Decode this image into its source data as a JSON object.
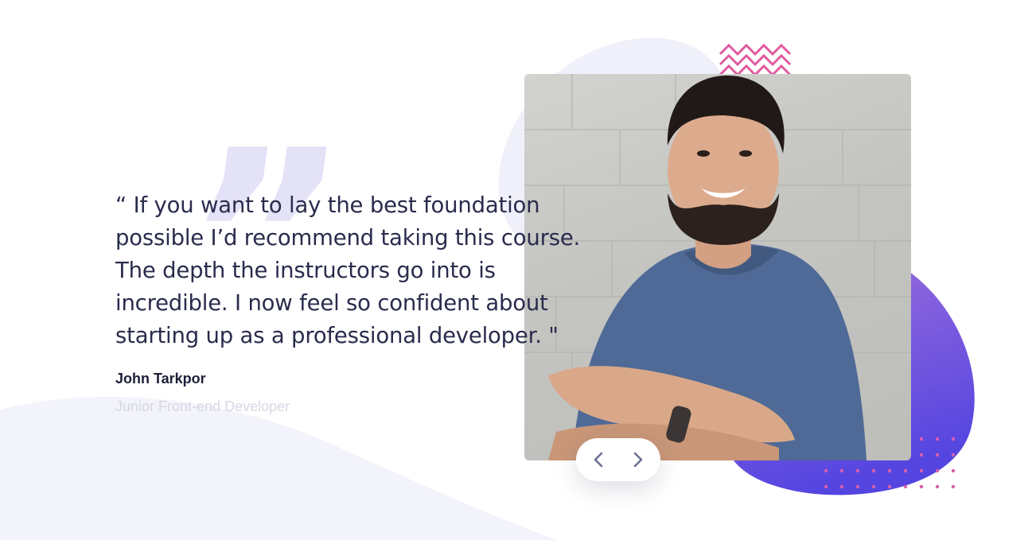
{
  "testimonial": {
    "quote": "“ If you want to lay the best foundation possible I’d recommend taking this course. The depth the instructors go into is incredible. I now feel so confident about starting up as a professional developer. \"",
    "author_name": "John Tarkpor",
    "author_role": "Junior Front-end Developer"
  },
  "decor": {
    "quote_mark": "”",
    "accent_pink": "#e05b9f",
    "accent_purple": "#6b46e0",
    "text_dark": "#2a2c4c"
  },
  "carousel": {
    "prev_icon": "chevron-left-icon",
    "next_icon": "chevron-right-icon"
  }
}
